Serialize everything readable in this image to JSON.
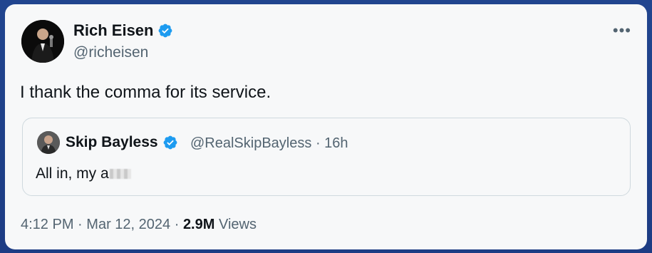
{
  "tweet": {
    "author_name": "Rich Eisen",
    "author_handle": "@richeisen",
    "text": "I thank the comma for its service.",
    "more_label": "•••",
    "verified_color": "#1d9bf0"
  },
  "quote": {
    "author_name": "Skip Bayless",
    "author_handle": "@RealSkipBayless",
    "separator": "·",
    "age": "16h",
    "text": "All in, my a"
  },
  "footer": {
    "time": "4:12 PM",
    "separator1": "·",
    "date": "Mar 12, 2024",
    "separator2": "·",
    "views_count": "2.9M",
    "views_label": "Views"
  }
}
